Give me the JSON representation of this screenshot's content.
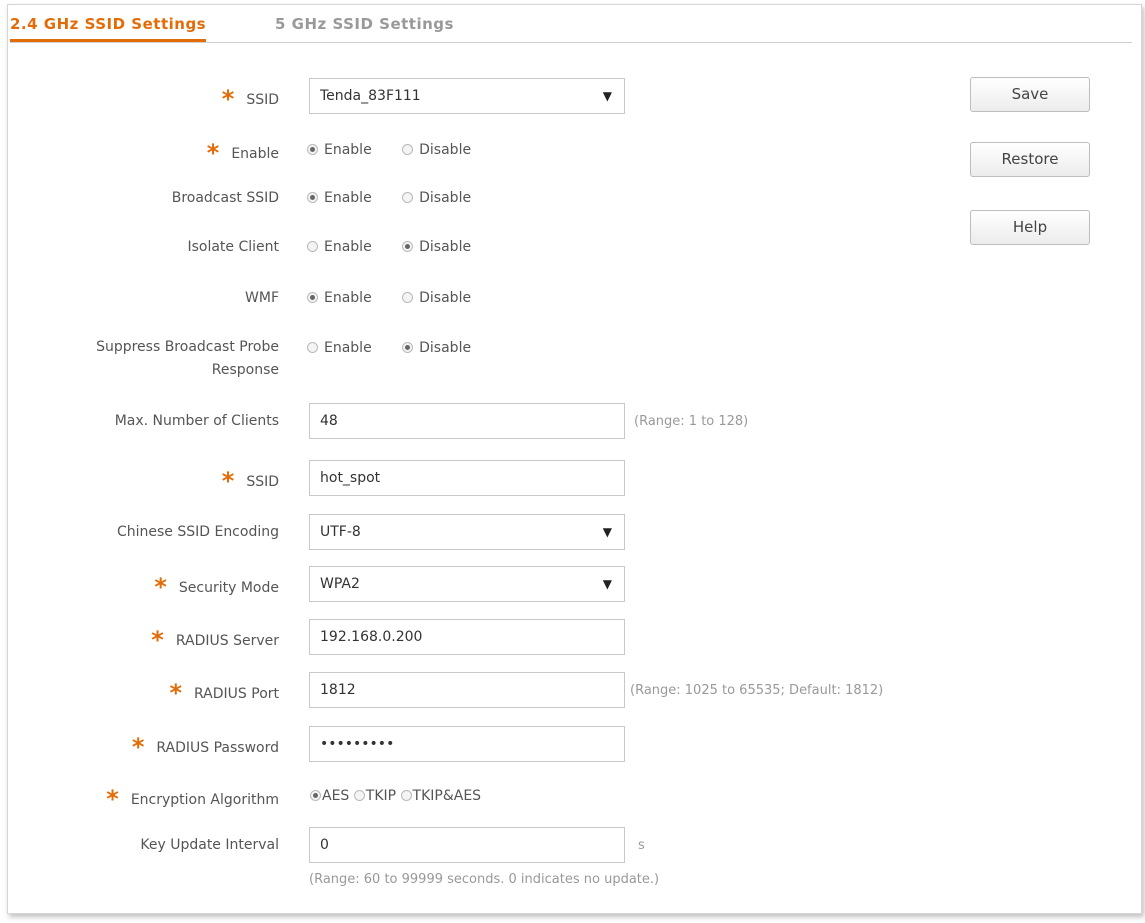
{
  "tabs": [
    {
      "label": "2.4 GHz SSID Settings",
      "active": true
    },
    {
      "label": "5 GHz SSID Settings",
      "active": false
    }
  ],
  "buttons": {
    "save": "Save",
    "restore": "Restore",
    "help": "Help"
  },
  "radio_options": {
    "enable": "Enable",
    "disable": "Disable"
  },
  "fields": {
    "ssid_select": {
      "label": "SSID",
      "value": "Tenda_83F111"
    },
    "enable": {
      "label": "Enable",
      "selected": "Enable"
    },
    "broadcast_ssid": {
      "label": "Broadcast SSID",
      "selected": "Enable"
    },
    "isolate_client": {
      "label": "Isolate Client",
      "selected": "Disable"
    },
    "wmf": {
      "label": "WMF",
      "selected": "Enable"
    },
    "suppress_probe": {
      "label": "Suppress Broadcast Probe Response",
      "selected": "Disable"
    },
    "max_clients": {
      "label": "Max. Number of Clients",
      "value": "48",
      "hint": "(Range: 1 to 128)"
    },
    "ssid_name": {
      "label": "SSID",
      "value": "hot_spot"
    },
    "chinese_encoding": {
      "label": "Chinese SSID Encoding",
      "value": "UTF-8"
    },
    "security_mode": {
      "label": "Security Mode",
      "value": "WPA2"
    },
    "radius_server": {
      "label": "RADIUS Server",
      "value": "192.168.0.200"
    },
    "radius_port": {
      "label": "RADIUS Port",
      "value": "1812",
      "hint": "(Range: 1025 to 65535; Default: 1812)"
    },
    "radius_password": {
      "label": "RADIUS Password",
      "value": "•••••••••"
    },
    "encryption_algorithm": {
      "label": "Encryption Algorithm",
      "options": [
        "AES",
        "TKIP",
        "TKIP&AES"
      ],
      "selected": "AES"
    },
    "key_update_interval": {
      "label": "Key Update Interval",
      "value": "0",
      "unit": "s",
      "hint": "(Range: 60 to 99999 seconds. 0 indicates no update.)"
    }
  },
  "required_marker": "*"
}
